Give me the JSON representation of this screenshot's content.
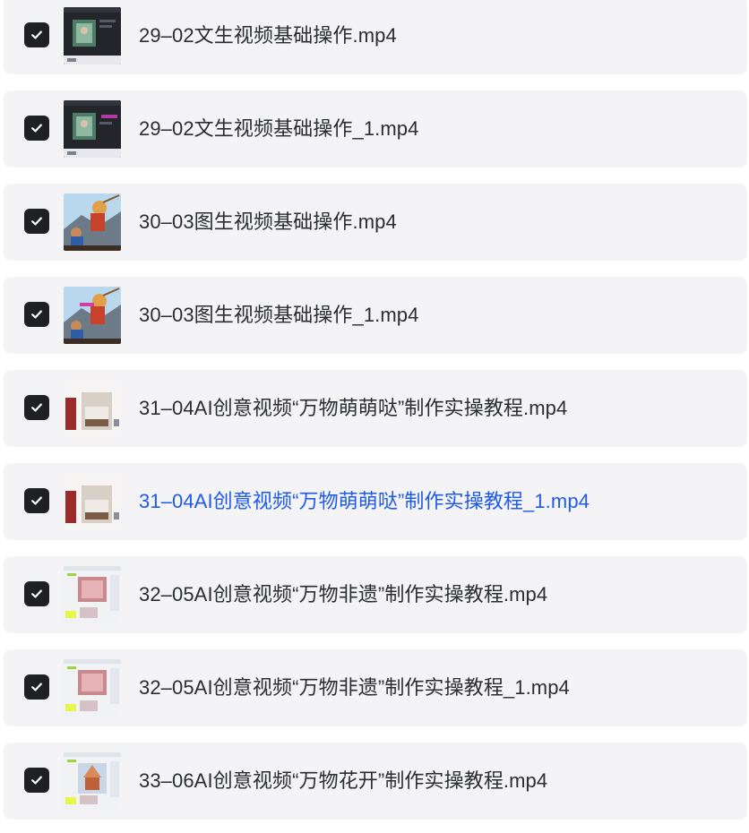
{
  "files": [
    {
      "name": "29–02文生视频基础操作.mp4",
      "checked": true,
      "thumb": "dark-ui-video-thumbnail",
      "active": false
    },
    {
      "name": "29–02文生视频基础操作_1.mp4",
      "checked": true,
      "thumb": "dark-ui-video-thumbnail",
      "active": false
    },
    {
      "name": "30–03图生视频基础操作.mp4",
      "checked": true,
      "thumb": "cartoon-battle-thumbnail",
      "active": false
    },
    {
      "name": "30–03图生视频基础操作_1.mp4",
      "checked": true,
      "thumb": "cartoon-battle-thumbnail",
      "active": false
    },
    {
      "name": "31–04AI创意视频“万物萌萌哒”制作实操教程.mp4",
      "checked": true,
      "thumb": "bedroom-scene-thumbnail",
      "active": false
    },
    {
      "name": "31–04AI创意视频“万物萌萌哒”制作实操教程_1.mp4",
      "checked": true,
      "thumb": "bedroom-scene-thumbnail",
      "active": true
    },
    {
      "name": "32–05AI创意视频“万物非遗”制作实操教程.mp4",
      "checked": true,
      "thumb": "web-app-screenshot-thumbnail",
      "active": false
    },
    {
      "name": "32–05AI创意视频“万物非遗”制作实操教程_1.mp4",
      "checked": true,
      "thumb": "web-app-screenshot-thumbnail",
      "active": false
    },
    {
      "name": "33–06AI创意视频“万物花开”制作实操教程.mp4",
      "checked": true,
      "thumb": "web-app-screenshot-thumbnail",
      "active": false
    }
  ],
  "icons": {
    "checkbox": "checkmark-icon"
  },
  "colors": {
    "row_background": "#f4f4f6",
    "checkbox_fill": "#1f2024",
    "text": "#2b2d33",
    "active_text": "#1f5ae8"
  }
}
